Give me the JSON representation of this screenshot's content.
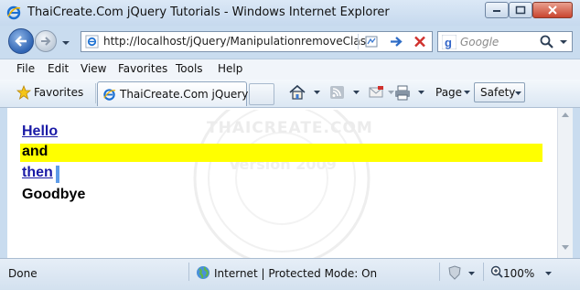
{
  "window": {
    "title": "ThaiCreate.Com jQuery Tutorials - Windows Internet Explorer",
    "icon": "ie-icon"
  },
  "address_bar": {
    "url": "http://localhost/jQuery/ManipulationremoveClas",
    "buttons": [
      "compatibility-view-icon",
      "go-icon",
      "stop-icon"
    ]
  },
  "search": {
    "placeholder": "Google"
  },
  "menu": {
    "items": [
      "File",
      "Edit",
      "View",
      "Favorites",
      "Tools",
      "Help"
    ]
  },
  "favorites_bar": {
    "favorites_label": "Favorites",
    "tab_label": "ThaiCreate.Com jQuery ...",
    "page_label": "Page",
    "safety_label": "Safety"
  },
  "content": {
    "watermark_title": "THAICREATE.COM",
    "watermark_version": "Version 2009",
    "lines": [
      {
        "text": "Hello",
        "style": "link"
      },
      {
        "text": "and",
        "style": "highlight"
      },
      {
        "text": "then",
        "style": "link"
      },
      {
        "text": "Goodbye",
        "style": "plain"
      }
    ],
    "highlight_color": "#ffff00",
    "link_color": "#1a1aa6"
  },
  "status_bar": {
    "status": "Done",
    "zone": "Internet | Protected Mode: On",
    "zoom": "100%"
  }
}
